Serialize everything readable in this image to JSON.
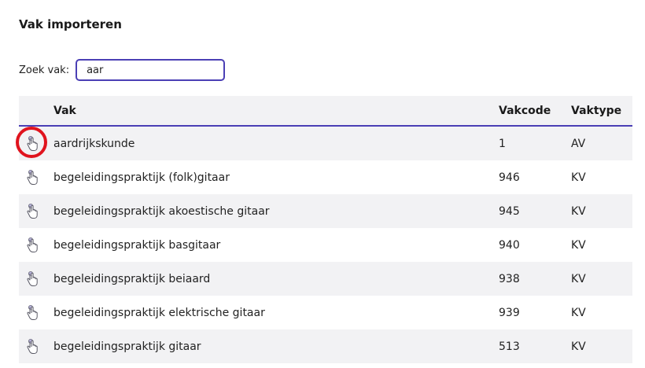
{
  "page": {
    "title": "Vak importeren"
  },
  "search": {
    "label": "Zoek vak:",
    "value": "aar"
  },
  "table": {
    "headers": {
      "vak": "Vak",
      "vakcode": "Vakcode",
      "vaktype": "Vaktype"
    },
    "rows": [
      {
        "vak": "aardrijkskunde",
        "vakcode": "1",
        "vaktype": "AV",
        "highlighted": true
      },
      {
        "vak": "begeleidingspraktijk (folk)gitaar",
        "vakcode": "946",
        "vaktype": "KV"
      },
      {
        "vak": "begeleidingspraktijk akoestische gitaar",
        "vakcode": "945",
        "vaktype": "KV"
      },
      {
        "vak": "begeleidingspraktijk basgitaar",
        "vakcode": "940",
        "vaktype": "KV"
      },
      {
        "vak": "begeleidingspraktijk beiaard",
        "vakcode": "938",
        "vaktype": "KV"
      },
      {
        "vak": "begeleidingspraktijk elektrische gitaar",
        "vakcode": "939",
        "vaktype": "KV"
      },
      {
        "vak": "begeleidingspraktijk gitaar",
        "vakcode": "513",
        "vaktype": "KV"
      }
    ]
  },
  "icons": {
    "row_action": "pointer-hand-icon",
    "highlight": "red-circle-annotation"
  },
  "colors": {
    "accent": "#4b3fb5",
    "row_stripe": "#f2f2f4",
    "highlight": "#e0141e"
  }
}
